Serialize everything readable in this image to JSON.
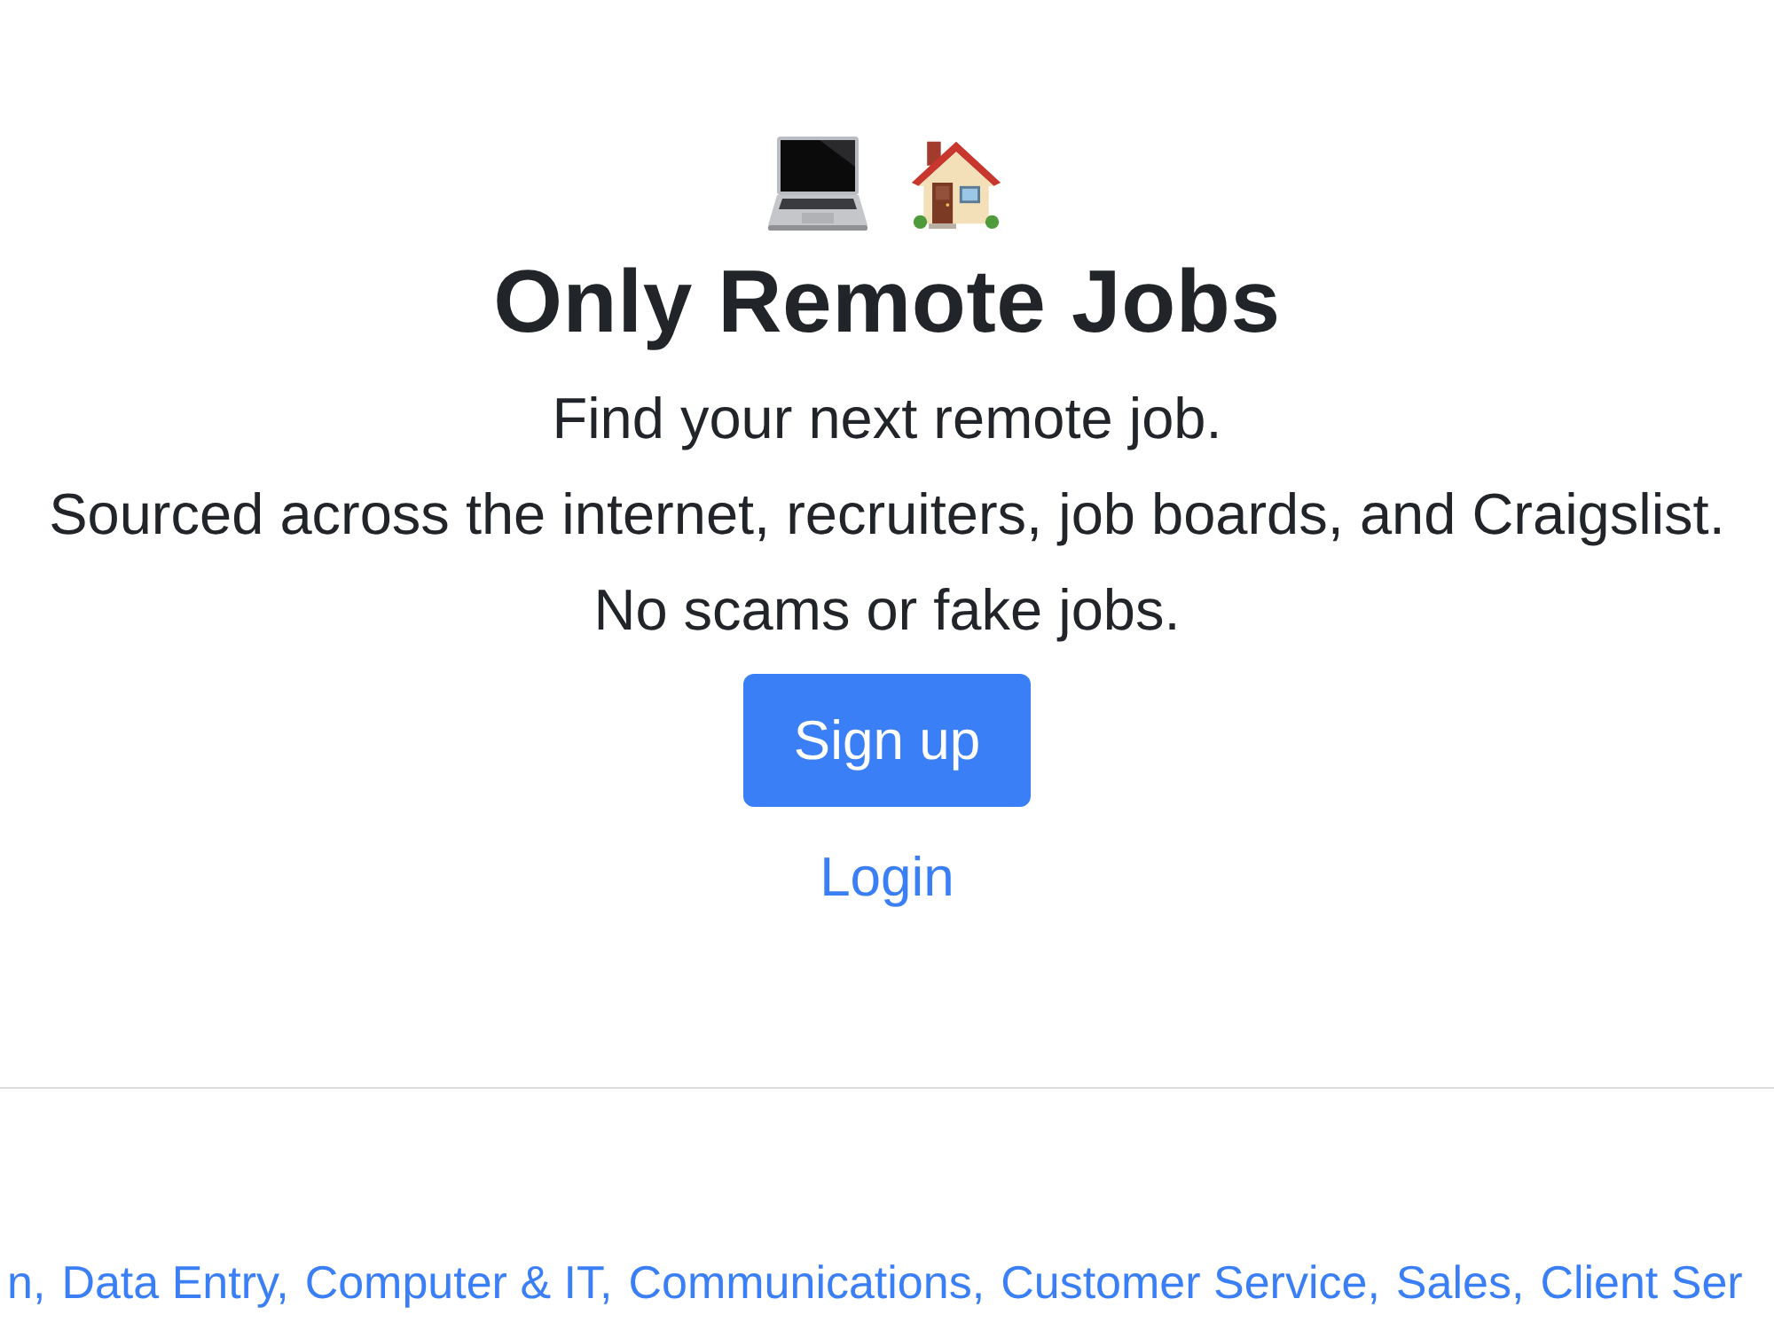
{
  "hero": {
    "title": "Only Remote Jobs",
    "taglines": [
      "Find your next remote job.",
      "Sourced across the internet, recruiters, job boards, and Craigslist.",
      "No scams or fake jobs."
    ],
    "signup_button": "Sign up",
    "login_link": "Login"
  },
  "categories": [
    "n,",
    "Data Entry,",
    "Computer & IT,",
    "Communications,",
    "Customer Service,",
    "Sales,",
    "Client Ser"
  ]
}
